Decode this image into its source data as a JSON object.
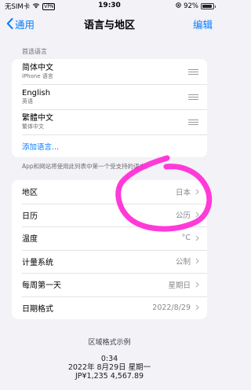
{
  "status_bar": {
    "carrier": "无SIM卡",
    "vpn": "VPN",
    "time": "19:30",
    "battery": "92%"
  },
  "nav": {
    "back_label": "通用",
    "title": "语言与地区",
    "edit_label": "编辑"
  },
  "preferred_languages": {
    "header": "首选语言",
    "items": [
      {
        "name": "简体中文",
        "sub": "iPhone 语言"
      },
      {
        "name": "English",
        "sub": "英语"
      },
      {
        "name": "繁體中文",
        "sub": "繁体中文"
      }
    ],
    "add_label": "添加语言...",
    "footer": "App和网站将使用此列表中第一个受支持的语言。"
  },
  "settings": [
    {
      "label": "地区",
      "value": "日本"
    },
    {
      "label": "日历",
      "value": "公历"
    },
    {
      "label": "温度",
      "value": "°C"
    },
    {
      "label": "计量系统",
      "value": "公制"
    },
    {
      "label": "每周第一天",
      "value": "星期日"
    },
    {
      "label": "日期格式",
      "value": "2022/8/29"
    }
  ],
  "format_example": {
    "title": "区域格式示例",
    "time": "0:34",
    "date": "2022年 8月29日 星期一",
    "numbers": "JP¥1,235    4,567.89"
  },
  "colors": {
    "accent": "#0a7cff",
    "annotation": "#ff2fd6"
  }
}
